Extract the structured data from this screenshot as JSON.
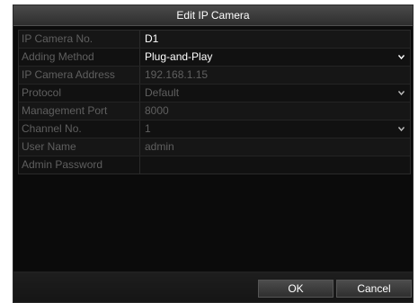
{
  "dialog": {
    "title": "Edit IP Camera"
  },
  "fields": [
    {
      "label": "IP Camera No.",
      "value": "D1"
    },
    {
      "label": "Adding Method",
      "value": "Plug-and-Play"
    },
    {
      "label": "IP Camera Address",
      "value": "192.168.1.15"
    },
    {
      "label": "Protocol",
      "value": "Default"
    },
    {
      "label": "Management Port",
      "value": "8000"
    },
    {
      "label": "Channel No.",
      "value": "1"
    },
    {
      "label": "User Name",
      "value": "admin"
    },
    {
      "label": "Admin Password",
      "value": ""
    }
  ],
  "buttons": {
    "ok_label": "OK",
    "cancel_label": "Cancel"
  },
  "icons": {
    "dropdown": "chevron-down-icon"
  },
  "colors": {
    "background": "#0b0b0b",
    "title_bar": "#3a3a3a",
    "active_text": "#ffffff",
    "disabled_text": "#5f5f5f"
  }
}
